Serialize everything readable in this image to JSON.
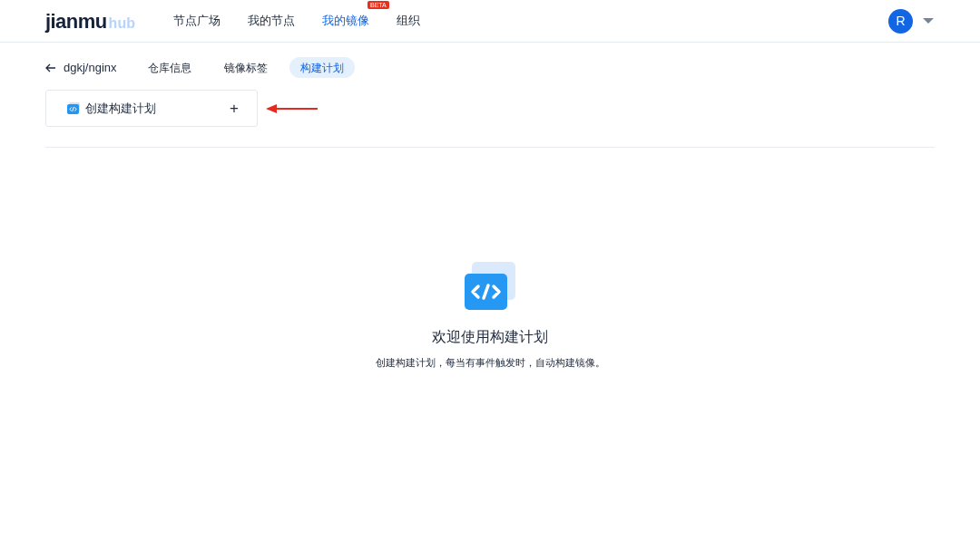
{
  "header": {
    "logo": {
      "main": "jianmu",
      "sub": "hub"
    },
    "nav": [
      {
        "label": "节点广场",
        "selected": false
      },
      {
        "label": "我的节点",
        "selected": false
      },
      {
        "label": "我的镜像",
        "selected": true,
        "badge": "BETA"
      },
      {
        "label": "组织",
        "selected": false
      }
    ],
    "avatar": "R"
  },
  "subnav": {
    "back": "dgkj/nginx",
    "tabs": [
      {
        "label": "仓库信息",
        "selected": false
      },
      {
        "label": "镜像标签",
        "selected": false
      },
      {
        "label": "构建计划",
        "selected": true
      }
    ]
  },
  "create_card": {
    "label": "创建构建计划",
    "action": "+"
  },
  "empty_state": {
    "title": "欢迎使用构建计划",
    "description": "创建构建计划，每当有事件触发时，自动构建镜像。"
  }
}
